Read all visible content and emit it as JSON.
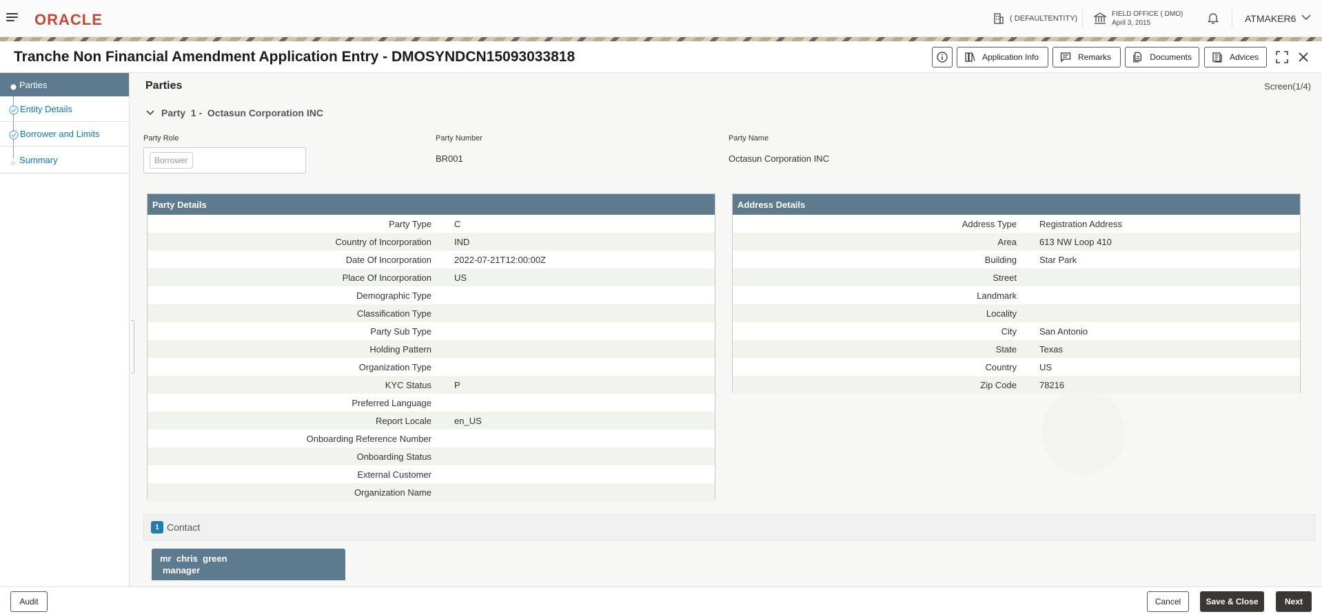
{
  "header": {
    "logo": "ORACLE",
    "entity": "( DEFAULTENTITY)",
    "office_name": "FIELD OFFICE ( DMO)",
    "office_date": "April 3, 2015",
    "user": "ATMAKER6"
  },
  "titlebar": {
    "title": "Tranche Non Financial Amendment Application Entry - DMOSYNDCN15093033818",
    "buttons": [
      "Application Info",
      "Remarks",
      "Documents",
      "Advices"
    ]
  },
  "nav": {
    "items": [
      {
        "label": "Parties",
        "state": "active"
      },
      {
        "label": "Entity Details",
        "state": "done"
      },
      {
        "label": "Borrower and Limits",
        "state": "done"
      },
      {
        "label": "Summary",
        "state": "pending"
      }
    ]
  },
  "main": {
    "heading": "Parties",
    "screen": "Screen(1/4)",
    "party_header": "Party  1 -  Octasun Corporation INC",
    "party_role_label": "Party Role",
    "party_role_value": "Borrower",
    "party_number_label": "Party Number",
    "party_number_value": "BR001",
    "party_name_label": "Party Name",
    "party_name_value": "Octasun Corporation INC"
  },
  "party_details": {
    "title": "Party Details",
    "rows": [
      {
        "label": "Party Type",
        "value": "C"
      },
      {
        "label": "Country of Incorporation",
        "value": "IND"
      },
      {
        "label": "Date Of Incorporation",
        "value": "2022-07-21T12:00:00Z"
      },
      {
        "label": "Place Of Incorporation",
        "value": "US"
      },
      {
        "label": "Demographic Type",
        "value": ""
      },
      {
        "label": "Classification Type",
        "value": ""
      },
      {
        "label": "Party Sub Type",
        "value": ""
      },
      {
        "label": "Holding Pattern",
        "value": ""
      },
      {
        "label": "Organization Type",
        "value": ""
      },
      {
        "label": "KYC Status",
        "value": "P"
      },
      {
        "label": "Preferred Language",
        "value": ""
      },
      {
        "label": "Report Locale",
        "value": "en_US"
      },
      {
        "label": "Onboarding Reference Number",
        "value": ""
      },
      {
        "label": "Onboarding Status",
        "value": ""
      },
      {
        "label": "External Customer",
        "value": ""
      },
      {
        "label": "Organization Name",
        "value": ""
      }
    ]
  },
  "address_details": {
    "title": "Address Details",
    "rows": [
      {
        "label": "Address Type",
        "value": "Registration Address"
      },
      {
        "label": "Area",
        "value": "613 NW Loop 410"
      },
      {
        "label": "Building",
        "value": "Star Park"
      },
      {
        "label": "Street",
        "value": ""
      },
      {
        "label": "Landmark",
        "value": ""
      },
      {
        "label": "Locality",
        "value": ""
      },
      {
        "label": "City",
        "value": "San Antonio"
      },
      {
        "label": "State",
        "value": "Texas"
      },
      {
        "label": "Country",
        "value": "US"
      },
      {
        "label": "Zip Code",
        "value": "78216"
      }
    ]
  },
  "contact": {
    "count": "1",
    "label": "Contact",
    "card_name": "mr  chris  green",
    "card_role": "manager"
  },
  "footer": {
    "audit": "Audit",
    "cancel": "Cancel",
    "save_close": "Save & Close",
    "next": "Next"
  }
}
